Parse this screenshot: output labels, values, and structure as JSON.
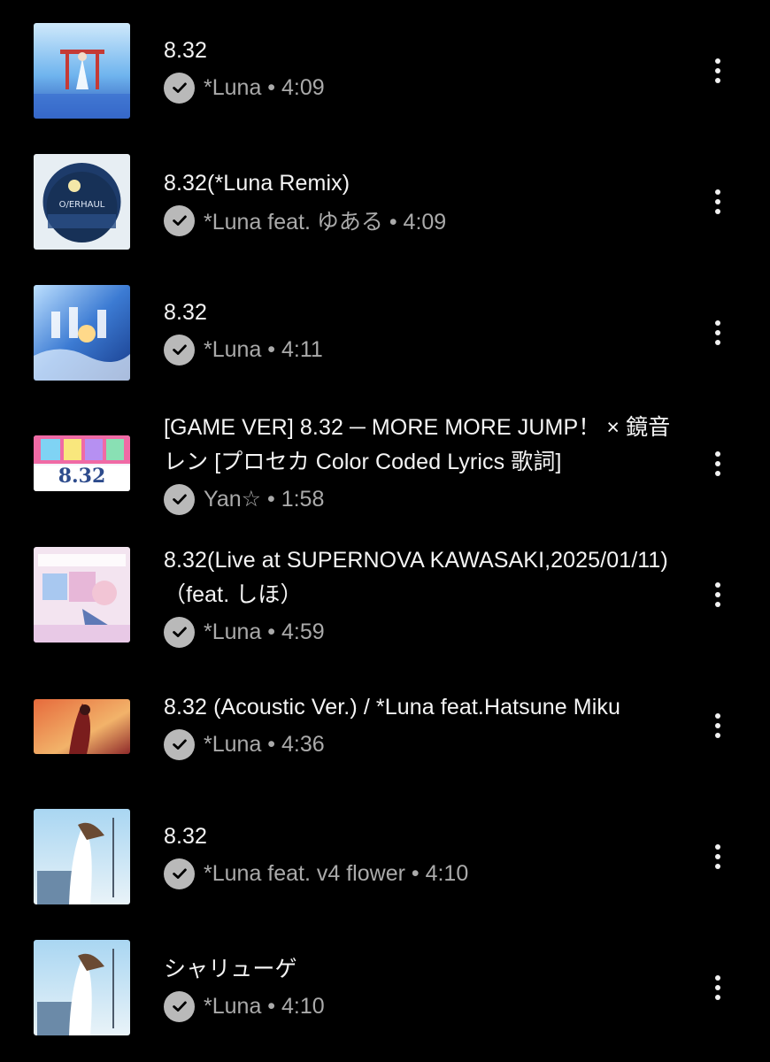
{
  "tracks": [
    {
      "title": "8.32",
      "artist": "*Luna",
      "duration": "4:09",
      "verified_icon": "check-circle-icon",
      "menu_icon": "more-vert-icon"
    },
    {
      "title": "8.32(*Luna Remix)",
      "artist": "*Luna feat. ゆある",
      "duration": "4:09",
      "verified_icon": "check-circle-icon",
      "menu_icon": "more-vert-icon"
    },
    {
      "title": "8.32",
      "artist": "*Luna",
      "duration": "4:11",
      "verified_icon": "check-circle-icon",
      "menu_icon": "more-vert-icon"
    },
    {
      "title": "[GAME VER] 8.32 ─ MORE MORE JUMP！ × 鏡音レン [プロセカ Color Coded Lyrics 歌詞]",
      "artist": "Yan☆",
      "duration": "1:58",
      "verified_icon": "check-circle-icon",
      "menu_icon": "more-vert-icon",
      "thumb_text": "8.32"
    },
    {
      "title": "8.32(Live at SUPERNOVA KAWASAKI,2025/01/11)（feat. しほ）",
      "artist": "*Luna",
      "duration": "4:59",
      "verified_icon": "check-circle-icon",
      "menu_icon": "more-vert-icon"
    },
    {
      "title": "8.32 (Acoustic Ver.) / *Luna feat.Hatsune Miku",
      "artist": "*Luna",
      "duration": "4:36",
      "verified_icon": "check-circle-icon",
      "menu_icon": "more-vert-icon"
    },
    {
      "title": "8.32",
      "artist": "*Luna feat. v4 flower",
      "duration": "4:10",
      "verified_icon": "check-circle-icon",
      "menu_icon": "more-vert-icon"
    },
    {
      "title": "シャリューゲ",
      "artist": "*Luna",
      "duration": "4:10",
      "verified_icon": "check-circle-icon",
      "menu_icon": "more-vert-icon"
    }
  ],
  "separator": " • "
}
